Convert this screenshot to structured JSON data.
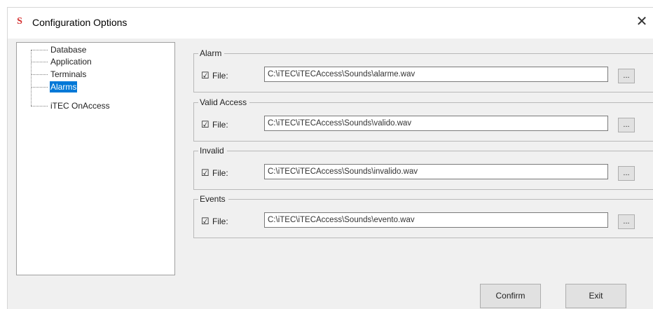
{
  "window": {
    "title": "Configuration Options",
    "icon": "app-s-icon",
    "close_glyph": "✕"
  },
  "tree": {
    "items": [
      {
        "label": "Database",
        "selected": false
      },
      {
        "label": "Application",
        "selected": false
      },
      {
        "label": "Terminals",
        "selected": false
      },
      {
        "label": "Alarms",
        "selected": true
      },
      {
        "label": "iTEC OnAccess",
        "selected": false
      }
    ]
  },
  "groups": [
    {
      "title": "Alarm",
      "checkbox_label": "File:",
      "checked": true,
      "path": "C:\\iTEC\\iTECAccess\\Sounds\\alarme.wav",
      "browse_label": "..."
    },
    {
      "title": "Valid Access",
      "checkbox_label": "File:",
      "checked": true,
      "path": "C:\\iTEC\\iTECAccess\\Sounds\\valido.wav",
      "browse_label": "..."
    },
    {
      "title": "Invalid",
      "checkbox_label": "File:",
      "checked": true,
      "path": "C:\\iTEC\\iTECAccess\\Sounds\\invalido.wav",
      "browse_label": "..."
    },
    {
      "title": "Events",
      "checkbox_label": "File:",
      "checked": true,
      "path": "C:\\iTEC\\iTECAccess\\Sounds\\evento.wav",
      "browse_label": "..."
    }
  ],
  "buttons": {
    "confirm_label": "Confirm",
    "exit_label": "Exit"
  },
  "colors": {
    "selection": "#0078d7",
    "window_bg": "#f0f0f0",
    "icon": "#d42b2b"
  }
}
